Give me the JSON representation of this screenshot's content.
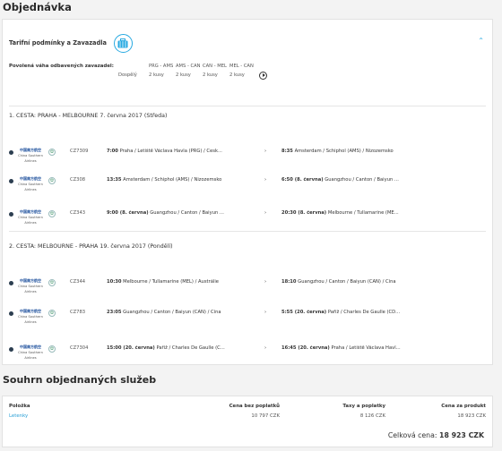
{
  "page_title": "Objednávka",
  "tariff": {
    "title": "Tarifní podmínky a Zavazadla",
    "collapse_icon": "chevron-up-icon",
    "baggage_label": "Povolená váha odbavených zavazadel:",
    "routes": [
      "PRG - AMS",
      "AMS - CAN",
      "CAN - MEL",
      "MEL - CAN"
    ],
    "passenger_type": "Dospělý",
    "allowances": [
      "2 kusy",
      "2 kusy",
      "2 kusy",
      "2 kusy"
    ]
  },
  "legs": [
    {
      "title": "1. CESTA: PRAHA - MELBOURNE 7. června 2017 (Středa)",
      "flights": [
        {
          "code": "CZ7309",
          "dep_time": "7:00",
          "dep_place": "Praha / Letiště Václava Havla (PRG) / Česk...",
          "arr_time": "8:35",
          "arr_place": "Amsterdam / Schiphol (AMS) / Nizozemsko"
        },
        {
          "code": "CZ308",
          "dep_time": "13:35",
          "dep_place": "Amsterdam / Schiphol (AMS) / Nizozemsko",
          "arr_time": "6:50 (8. června)",
          "arr_place": "Guangzhou / Canton / Baiyun ..."
        },
        {
          "code": "CZ343",
          "dep_time": "9:00 (8. června)",
          "dep_place": "Guangzhou / Canton / Baiyun ...",
          "arr_time": "20:30 (8. června)",
          "arr_place": "Melbourne / Tullamarine (ME..."
        }
      ]
    },
    {
      "title": "2. CESTA: MELBOURNE - PRAHA 19. června 2017 (Pondělí)",
      "flights": [
        {
          "code": "CZ344",
          "dep_time": "10:30",
          "dep_place": "Melbourne / Tullamarine (MEL) / Austrálie",
          "arr_time": "18:10",
          "arr_place": "Guangzhou / Canton / Baiyun (CAN) / Čína"
        },
        {
          "code": "CZ783",
          "dep_time": "23:05",
          "dep_place": "Guangzhou / Canton / Baiyun (CAN) / Čína",
          "arr_time": "5:55 (20. června)",
          "arr_place": "Paříž / Charles De Gaulle (CD..."
        },
        {
          "code": "CZ7304",
          "dep_time": "15:00 (20. června)",
          "dep_place": "Paříž / Charles De Gaulle (C...",
          "arr_time": "16:45 (20. června)",
          "arr_place": "Praha / Letiště Václava Havl..."
        }
      ]
    }
  ],
  "airline": {
    "cn": "中国南方航空",
    "en_line1": "China Southern",
    "en_line2": "Airlines"
  },
  "summary": {
    "title": "Souhrn objednaných služeb",
    "headers": [
      "Položka",
      "Cena bez poplatků",
      "Taxy a poplatky",
      "Cena za produkt"
    ],
    "row": [
      "Letenky",
      "10 797 CZK",
      "8 126 CZK",
      "18 923 CZK"
    ],
    "total_label": "Celková cena:",
    "total_value": "18 923 CZK"
  },
  "colors": {
    "accent": "#27a9e1",
    "link": "#2a9fd6"
  }
}
